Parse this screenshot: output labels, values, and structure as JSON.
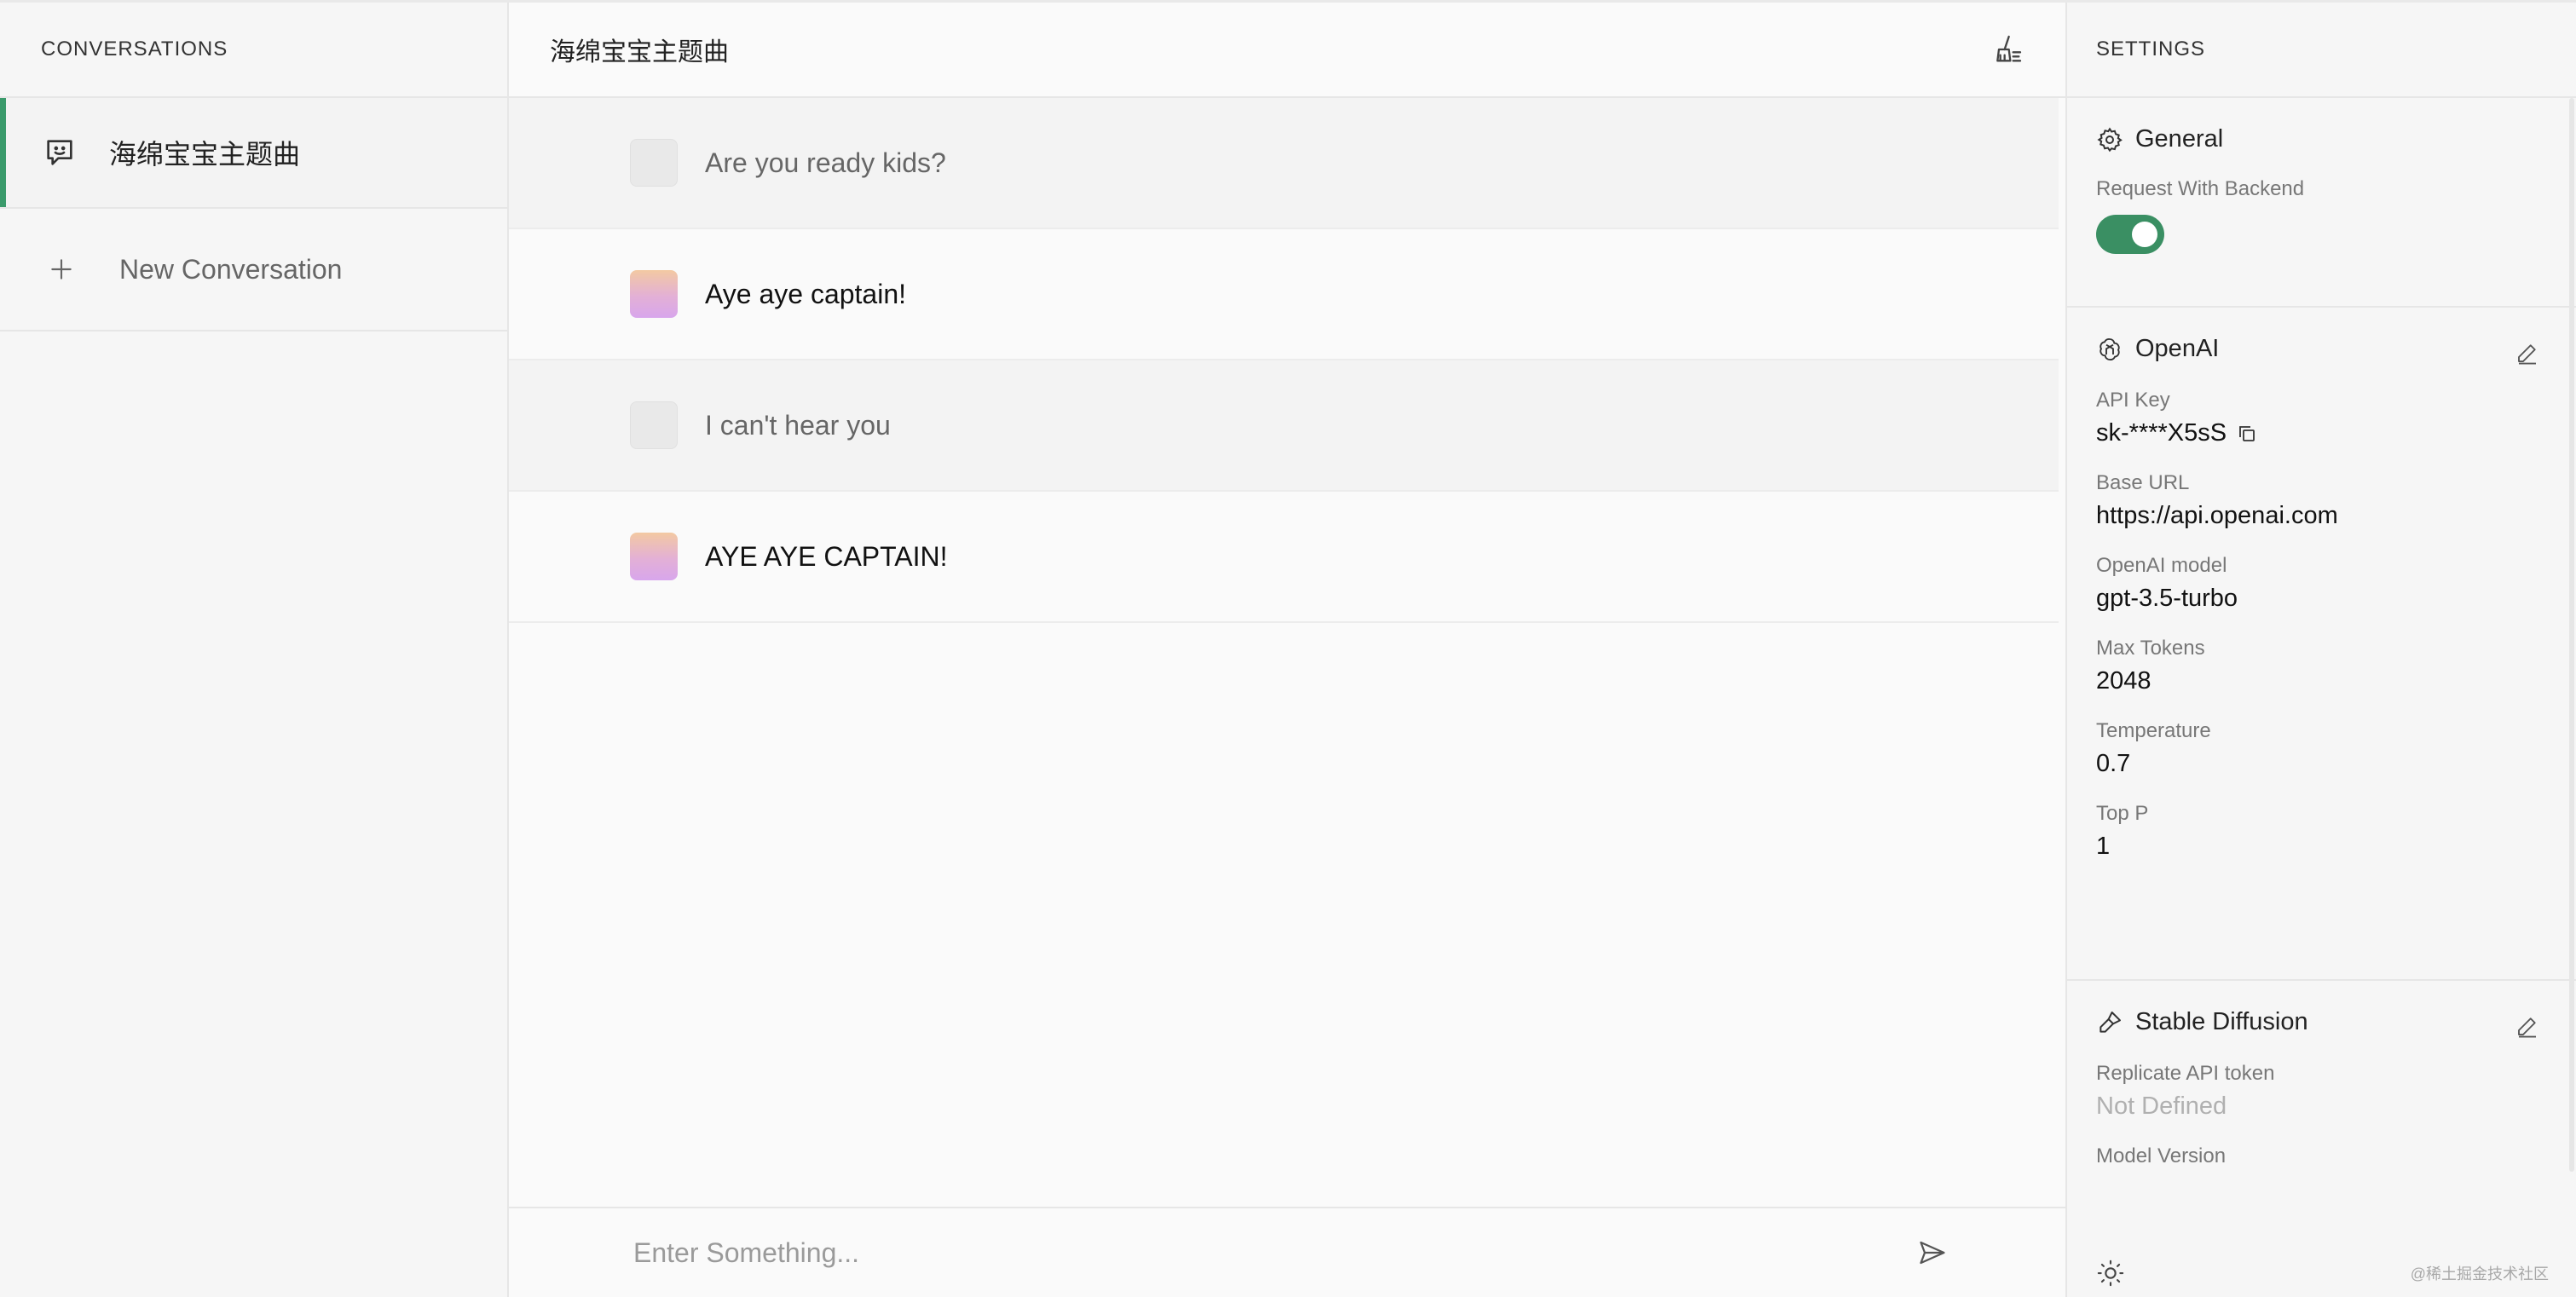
{
  "sidebar": {
    "header": "CONVERSATIONS",
    "conversations": [
      {
        "title": "海绵宝宝主题曲",
        "icon": "chat-smile-icon",
        "active": true
      }
    ],
    "new_conversation_label": "New Conversation",
    "accent_color": "#3a9a6b"
  },
  "main": {
    "title": "海绵宝宝主题曲",
    "clear_icon": "broom-icon",
    "messages": [
      {
        "role": "user",
        "text": "Are you ready kids?"
      },
      {
        "role": "assistant",
        "text": "Aye aye captain!"
      },
      {
        "role": "user",
        "text": "I can't hear you"
      },
      {
        "role": "assistant",
        "text": "AYE AYE CAPTAIN!"
      }
    ],
    "input_placeholder": "Enter Something...",
    "send_icon": "send-icon"
  },
  "settings": {
    "header": "SETTINGS",
    "general": {
      "title": "General",
      "request_with_backend_label": "Request With Backend",
      "request_with_backend": true
    },
    "openai": {
      "title": "OpenAI",
      "api_key_label": "API Key",
      "api_key": "sk-****X5sS",
      "base_url_label": "Base URL",
      "base_url": "https://api.openai.com",
      "model_label": "OpenAI model",
      "model": "gpt-3.5-turbo",
      "max_tokens_label": "Max Tokens",
      "max_tokens": "2048",
      "temperature_label": "Temperature",
      "temperature": "0.7",
      "top_p_label": "Top P",
      "top_p": "1"
    },
    "stable_diffusion": {
      "title": "Stable Diffusion",
      "token_label": "Replicate API token",
      "token": "Not Defined",
      "model_version_label": "Model Version"
    },
    "footer_watermark": "@稀土掘金技术社区",
    "toggle_color": "#3a8f63"
  }
}
